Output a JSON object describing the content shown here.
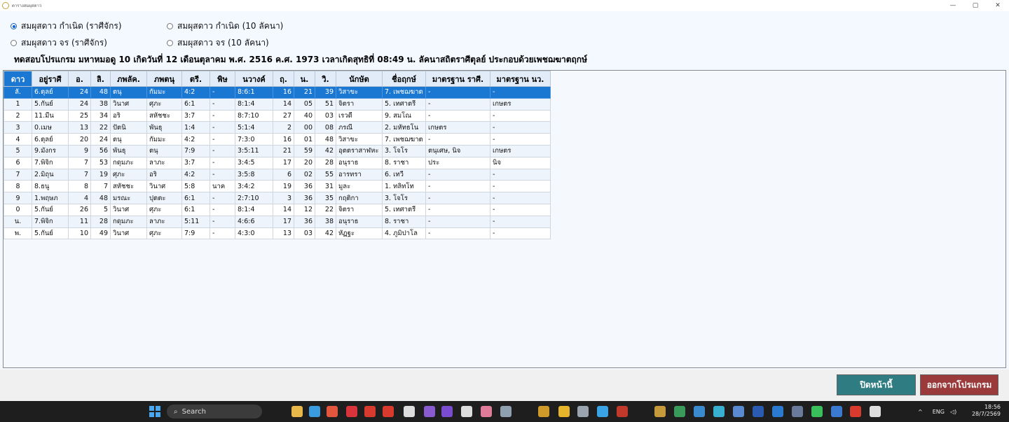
{
  "window": {
    "title": "ตารางสมผุสดาว",
    "minimize": "—",
    "maximize": "▢",
    "close": "✕"
  },
  "options": {
    "natal_rasi": "สมผุสดาว กำเนิด (ราศีจักร)",
    "natal_lagna": "สมผุสดาว กำเนิด (10 ลัคนา)",
    "transit_rasi": "สมผุสดาว จร (ราศีจักร)",
    "transit_lagna": "สมผุสดาว จร (10 ลัคนา)",
    "selected": "natal_rasi"
  },
  "info_line": "ทดสอบโปรแกรม มหาหมอดู 10 เกิดวันที่ 12 เดือนตุลาคม พ.ศ. 2516 ค.ศ. 1973 เวลาเกิดสุทธิที่ 08:49 น. ลัคนาสถิตราศีตุลย์ ประกอบด้วยเพชฌฆาตฤกษ์",
  "table": {
    "headers": [
      "ดาว",
      "อยู่ราศี",
      "อ.",
      "ลิ.",
      "ภพลัค.",
      "ภพตนุ",
      "ตรี.",
      "พิษ",
      "นวางค์",
      "ฤ.",
      "น.",
      "วิ.",
      "นักษัต",
      "ชื่อฤกษ์",
      "มาตรฐาน ราศี.",
      "มาตรฐาน นว."
    ],
    "rows": [
      [
        "ลั.",
        "6.ตุลย์",
        "24",
        "48",
        "ตนุ",
        "กัมมะ",
        "4:2",
        "-",
        "8:6:1",
        "16",
        "21",
        "39",
        "วิสาขะ",
        "7. เพชฌฆาต",
        "-",
        "-"
      ],
      [
        "1",
        "5.กันย์",
        "24",
        "38",
        "วินาศ",
        "ศุภะ",
        "6:1",
        "-",
        "8:1:4",
        "14",
        "05",
        "51",
        "จิตรา",
        "5. เทศาตรี",
        "-",
        "เกษตร"
      ],
      [
        "2",
        "11.มีน",
        "25",
        "34",
        "อริ",
        "สหัชชะ",
        "3:7",
        "-",
        "8:7:10",
        "27",
        "40",
        "03",
        "เรวดี",
        "9. สมโณ",
        "-",
        "-"
      ],
      [
        "3",
        "0.เมษ",
        "13",
        "22",
        "ปัตนิ",
        "พันธุ",
        "1:4",
        "-",
        "5:1:4",
        "2",
        "00",
        "08",
        "ภรณี",
        "2. มหัทธโน",
        "เกษตร",
        "-"
      ],
      [
        "4",
        "6.ตุลย์",
        "20",
        "24",
        "ตนุ",
        "กัมมะ",
        "4:2",
        "-",
        "7:3:0",
        "16",
        "01",
        "48",
        "วิสาขะ",
        "7. เพชฌฆาต",
        "-",
        "-"
      ],
      [
        "5",
        "9.มังกร",
        "9",
        "56",
        "พันธุ",
        "ตนุ",
        "7:9",
        "-",
        "3:5:11",
        "21",
        "59",
        "42",
        "อุตตราสาฬหะ",
        "3. โจโร",
        "ตนุเศษ, นิจ",
        "เกษตร"
      ],
      [
        "6",
        "7.พิจิก",
        "7",
        "53",
        "กดุมภะ",
        "ลาภะ",
        "3:7",
        "-",
        "3:4:5",
        "17",
        "20",
        "28",
        "อนุราธ",
        "8. ราชา",
        "ประ",
        "นิจ"
      ],
      [
        "7",
        "2.มิถุน",
        "7",
        "19",
        "ศุภะ",
        "อริ",
        "4:2",
        "-",
        "3:5:8",
        "6",
        "02",
        "55",
        "อารทรา",
        "6. เทวี",
        "-",
        "-"
      ],
      [
        "8",
        "8.ธนู",
        "8",
        "7",
        "สหัชชะ",
        "วินาศ",
        "5:8",
        "นาค",
        "3:4:2",
        "19",
        "36",
        "31",
        "มูละ",
        "1. ทลิทโท",
        "-",
        "-"
      ],
      [
        "9",
        "1.พฤษภ",
        "4",
        "48",
        "มรณะ",
        "ปุตตะ",
        "6:1",
        "-",
        "2:7:10",
        "3",
        "36",
        "35",
        "กฤติกา",
        "3. โจโร",
        "-",
        "-"
      ],
      [
        "0",
        "5.กันย์",
        "26",
        "5",
        "วินาศ",
        "ศุภะ",
        "6:1",
        "-",
        "8:1:4",
        "14",
        "12",
        "22",
        "จิตรา",
        "5. เทศาตรี",
        "-",
        "-"
      ],
      [
        "น.",
        "7.พิจิก",
        "11",
        "28",
        "กดุมภะ",
        "ลาภะ",
        "5:11",
        "-",
        "4:6:6",
        "17",
        "36",
        "38",
        "อนุราธ",
        "8. ราชา",
        "-",
        "-"
      ],
      [
        "พ.",
        "5.กันย์",
        "10",
        "49",
        "วินาศ",
        "ศุภะ",
        "7:9",
        "-",
        "4:3:0",
        "13",
        "03",
        "42",
        "หัฏฐะ",
        "4. ภูมิปาโล",
        "-",
        "-"
      ]
    ],
    "selected_row": 0
  },
  "buttons": {
    "close_page": "ปิดหน้านี้",
    "exit_program": "ออกจากโปรแกรม"
  },
  "taskbar": {
    "search_placeholder": "Search",
    "language": "ENG",
    "time": "18:56",
    "date": "28/7/2569"
  },
  "colors": {
    "selection": "#1a77d2",
    "close_button": "#2f7d82",
    "exit_button": "#9b3a3a"
  }
}
